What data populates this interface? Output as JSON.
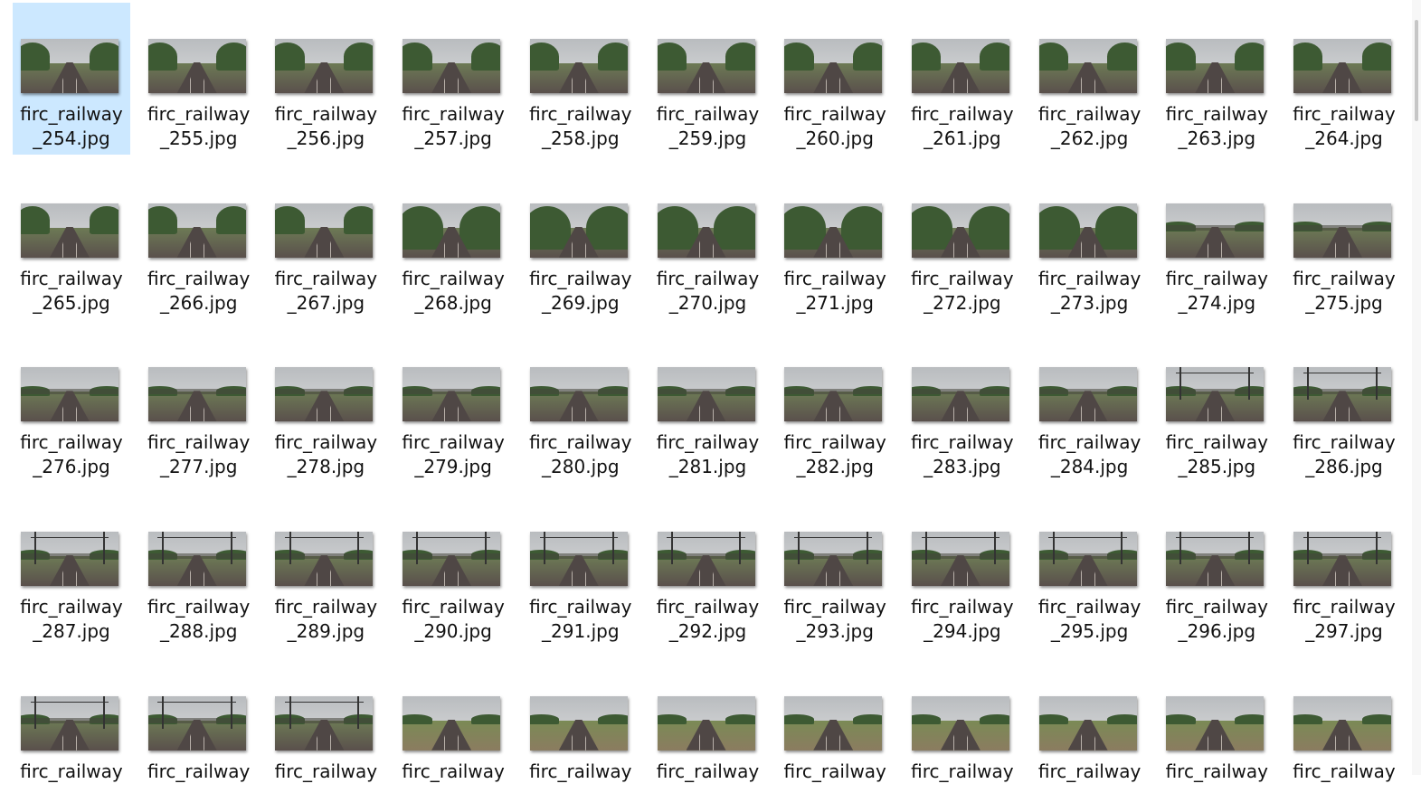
{
  "files": [
    {
      "name1": "firc_railway",
      "name2": "_254.jpg",
      "scene": "trees",
      "selected": true
    },
    {
      "name1": "firc_railway",
      "name2": "_255.jpg",
      "scene": "trees"
    },
    {
      "name1": "firc_railway",
      "name2": "_256.jpg",
      "scene": "trees"
    },
    {
      "name1": "firc_railway",
      "name2": "_257.jpg",
      "scene": "trees"
    },
    {
      "name1": "firc_railway",
      "name2": "_258.jpg",
      "scene": "trees"
    },
    {
      "name1": "firc_railway",
      "name2": "_259.jpg",
      "scene": "trees"
    },
    {
      "name1": "firc_railway",
      "name2": "_260.jpg",
      "scene": "trees"
    },
    {
      "name1": "firc_railway",
      "name2": "_261.jpg",
      "scene": "trees"
    },
    {
      "name1": "firc_railway",
      "name2": "_262.jpg",
      "scene": "trees"
    },
    {
      "name1": "firc_railway",
      "name2": "_263.jpg",
      "scene": "trees"
    },
    {
      "name1": "firc_railway",
      "name2": "_264.jpg",
      "scene": "trees"
    },
    {
      "name1": "firc_railway",
      "name2": "_265.jpg",
      "scene": "trees"
    },
    {
      "name1": "firc_railway",
      "name2": "_266.jpg",
      "scene": "trees"
    },
    {
      "name1": "firc_railway",
      "name2": "_267.jpg",
      "scene": "trees"
    },
    {
      "name1": "firc_railway",
      "name2": "_268.jpg",
      "scene": "dense"
    },
    {
      "name1": "firc_railway",
      "name2": "_269.jpg",
      "scene": "dense"
    },
    {
      "name1": "firc_railway",
      "name2": "_270.jpg",
      "scene": "dense"
    },
    {
      "name1": "firc_railway",
      "name2": "_271.jpg",
      "scene": "dense"
    },
    {
      "name1": "firc_railway",
      "name2": "_272.jpg",
      "scene": "dense"
    },
    {
      "name1": "firc_railway",
      "name2": "_273.jpg",
      "scene": "dense"
    },
    {
      "name1": "firc_railway",
      "name2": "_274.jpg",
      "scene": "station"
    },
    {
      "name1": "firc_railway",
      "name2": "_275.jpg",
      "scene": "station"
    },
    {
      "name1": "firc_railway",
      "name2": "_276.jpg",
      "scene": "station"
    },
    {
      "name1": "firc_railway",
      "name2": "_277.jpg",
      "scene": "station"
    },
    {
      "name1": "firc_railway",
      "name2": "_278.jpg",
      "scene": "station"
    },
    {
      "name1": "firc_railway",
      "name2": "_279.jpg",
      "scene": "station"
    },
    {
      "name1": "firc_railway",
      "name2": "_280.jpg",
      "scene": "station"
    },
    {
      "name1": "firc_railway",
      "name2": "_281.jpg",
      "scene": "station"
    },
    {
      "name1": "firc_railway",
      "name2": "_282.jpg",
      "scene": "station"
    },
    {
      "name1": "firc_railway",
      "name2": "_283.jpg",
      "scene": "station"
    },
    {
      "name1": "firc_railway",
      "name2": "_284.jpg",
      "scene": "station"
    },
    {
      "name1": "firc_railway",
      "name2": "_285.jpg",
      "scene": "catenary"
    },
    {
      "name1": "firc_railway",
      "name2": "_286.jpg",
      "scene": "catenary"
    },
    {
      "name1": "firc_railway",
      "name2": "_287.jpg",
      "scene": "catenary"
    },
    {
      "name1": "firc_railway",
      "name2": "_288.jpg",
      "scene": "catenary"
    },
    {
      "name1": "firc_railway",
      "name2": "_289.jpg",
      "scene": "catenary"
    },
    {
      "name1": "firc_railway",
      "name2": "_290.jpg",
      "scene": "catenary"
    },
    {
      "name1": "firc_railway",
      "name2": "_291.jpg",
      "scene": "catenary"
    },
    {
      "name1": "firc_railway",
      "name2": "_292.jpg",
      "scene": "catenary"
    },
    {
      "name1": "firc_railway",
      "name2": "_293.jpg",
      "scene": "catenary"
    },
    {
      "name1": "firc_railway",
      "name2": "_294.jpg",
      "scene": "catenary"
    },
    {
      "name1": "firc_railway",
      "name2": "_295.jpg",
      "scene": "catenary"
    },
    {
      "name1": "firc_railway",
      "name2": "_296.jpg",
      "scene": "catenary"
    },
    {
      "name1": "firc_railway",
      "name2": "_297.jpg",
      "scene": "catenary"
    },
    {
      "name1": "firc_railway",
      "name2": "",
      "scene": "catenary"
    },
    {
      "name1": "firc_railway",
      "name2": "",
      "scene": "catenary"
    },
    {
      "name1": "firc_railway",
      "name2": "",
      "scene": "catenary"
    },
    {
      "name1": "firc_railway",
      "name2": "",
      "scene": "field"
    },
    {
      "name1": "firc_railway",
      "name2": "",
      "scene": "field"
    },
    {
      "name1": "firc_railway",
      "name2": "",
      "scene": "field"
    },
    {
      "name1": "firc_railway",
      "name2": "",
      "scene": "field"
    },
    {
      "name1": "firc_railway",
      "name2": "",
      "scene": "field"
    },
    {
      "name1": "firc_railway",
      "name2": "",
      "scene": "field"
    },
    {
      "name1": "firc_railway",
      "name2": "",
      "scene": "field"
    },
    {
      "name1": "firc_railway",
      "name2": "",
      "scene": "field"
    }
  ],
  "colors": {
    "selection_bg": "#cce8ff",
    "sky": "#c9cbcd",
    "trees": "#3d5a33",
    "grass": "#6d7a55",
    "ballast": "#5a504c"
  }
}
